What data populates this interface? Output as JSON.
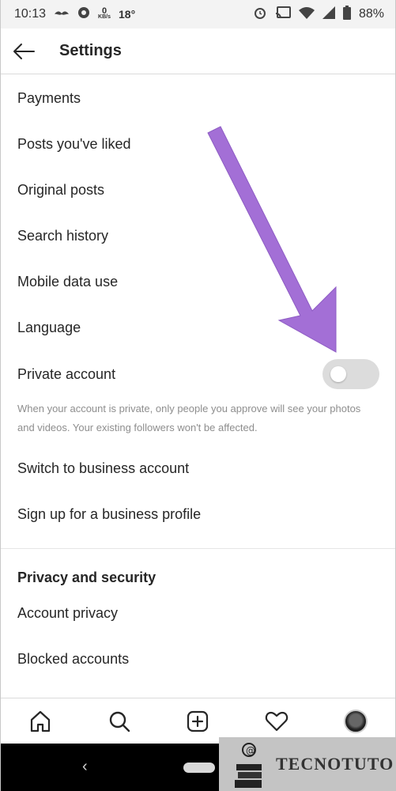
{
  "status_bar": {
    "time": "10:13",
    "net_speed": "0",
    "net_unit": "KB/s",
    "temperature": "18°",
    "battery": "88%"
  },
  "header": {
    "title": "Settings"
  },
  "items": [
    {
      "label": "Payments"
    },
    {
      "label": "Posts you've liked"
    },
    {
      "label": "Original posts"
    },
    {
      "label": "Search history"
    },
    {
      "label": "Mobile data use"
    },
    {
      "label": "Language"
    }
  ],
  "private_account": {
    "label": "Private account",
    "enabled": false,
    "hint": "When your account is private, only people you approve will see your photos and videos. Your existing followers won't be affected."
  },
  "business": [
    {
      "label": "Switch to business account"
    },
    {
      "label": "Sign up for a business profile"
    }
  ],
  "privacy_section": {
    "title": "Privacy and security",
    "items": [
      {
        "label": "Account privacy"
      },
      {
        "label": "Blocked accounts"
      }
    ]
  },
  "watermark": {
    "text": "TECNOTUTO"
  },
  "colors": {
    "arrow": "#a36fd6",
    "toggle_off": "#dcdcdc"
  }
}
